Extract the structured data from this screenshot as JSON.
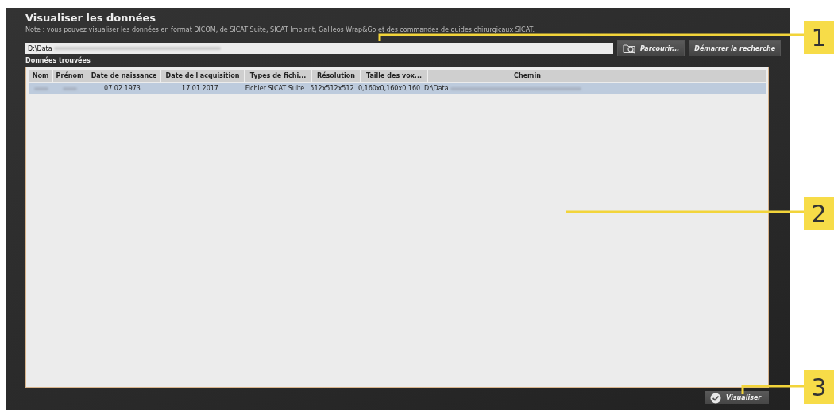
{
  "title": "Visualiser les données",
  "note": "Note : vous pouvez visualiser les données en format DICOM, de SICAT Suite, SICAT Implant, Galileos Wrap&Go et des commandes de guides chirurgicaux SICAT.",
  "path_field": {
    "value": "D:\\Data"
  },
  "buttons": [
    {
      "label": "Parcourir...",
      "kind": "browse"
    },
    {
      "label": "Démarrer la recherche",
      "kind": "plain"
    }
  ],
  "results_label": "Données trouvées",
  "table": {
    "columns": [
      "Nom",
      "Prénom",
      "Date de naissance",
      "Date de l'acquisition",
      "Types de fichi...",
      "Résolution",
      "Taille des vox...",
      "Chemin"
    ],
    "rows": [
      {
        "selected": true,
        "cells": [
          {
            "kind": "blurred"
          },
          {
            "kind": "blurred"
          },
          {
            "kind": "text",
            "text": "07.02.1973"
          },
          {
            "kind": "text",
            "text": "17.01.2017"
          },
          {
            "kind": "text",
            "text": "Fichier SICAT Suite"
          },
          {
            "kind": "text",
            "text": "512x512x512"
          },
          {
            "kind": "text",
            "text": "0,160x0,160x0,160"
          },
          {
            "kind": "path",
            "text": "D:\\Data"
          }
        ]
      }
    ]
  },
  "confirm_button": {
    "label": "Visualiser"
  },
  "callouts": [
    "1",
    "2",
    "3"
  ]
}
